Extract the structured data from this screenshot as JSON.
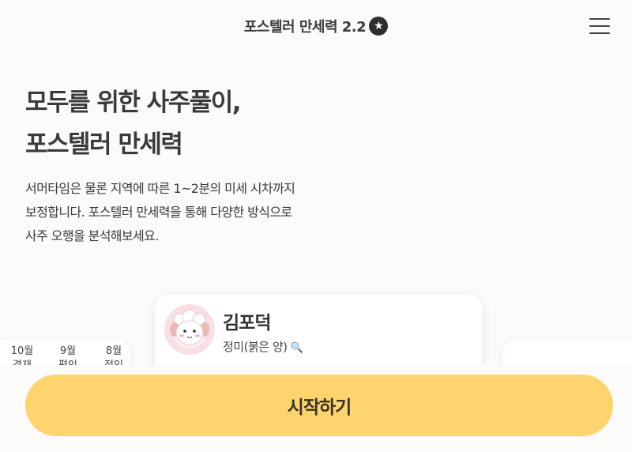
{
  "header": {
    "title": "포스텔러 만세력 2.2",
    "badge_glyph": "★",
    "menu_icon": "hamburger-menu-icon"
  },
  "hero": {
    "title_line1": "모두를 위한 사주풀이,",
    "title_line2": "포스텔러 만세력",
    "desc_line1": "서머타임은 물론 지역에 따른 1~2분의 미세 시차까지",
    "desc_line2": "보정합니다. 포스텔러 만세력을 통해 다양한 방식으로",
    "desc_line3": "사주 오행을 분석해보세요."
  },
  "left_card": {
    "months": [
      {
        "month": "10월",
        "sub": "경재"
      },
      {
        "month": "9월",
        "sub": "편인"
      },
      {
        "month": "8월",
        "sub": "정인"
      }
    ]
  },
  "profile_card": {
    "name": "김포덕",
    "subtitle": "정미(붉은 양)",
    "subtitle_icon": "🔍",
    "avatar": "sheep-avatar"
  },
  "cta": {
    "label": "시작하기",
    "color": "#fed46f"
  },
  "colors": {
    "background": "#fcfbf9",
    "text": "#3a3a3a",
    "avatar_bg": "#f7dfe3"
  }
}
